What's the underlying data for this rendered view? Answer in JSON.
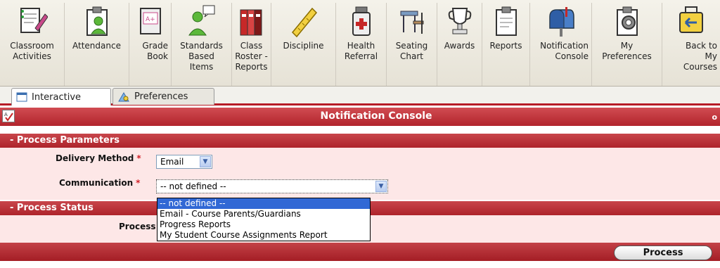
{
  "toolbar": {
    "items": [
      {
        "id": "classroom",
        "lines": [
          "Classroom",
          "Activities"
        ]
      },
      {
        "id": "attendance",
        "lines": [
          "Attendance"
        ]
      },
      {
        "id": "gradebook",
        "lines": [
          "Grade",
          "Book"
        ]
      },
      {
        "id": "standards",
        "lines": [
          "Standards",
          "Based",
          "Items"
        ]
      },
      {
        "id": "roster",
        "lines": [
          "Class",
          "Roster -",
          "Reports"
        ]
      },
      {
        "id": "discipline",
        "lines": [
          "Discipline"
        ]
      },
      {
        "id": "health",
        "lines": [
          "Health",
          "Referral"
        ]
      },
      {
        "id": "seating",
        "lines": [
          "Seating",
          "Chart"
        ]
      },
      {
        "id": "awards",
        "lines": [
          "Awards"
        ]
      },
      {
        "id": "reports",
        "lines": [
          "Reports"
        ]
      },
      {
        "id": "notification",
        "lines": [
          "Notification",
          "Console"
        ]
      },
      {
        "id": "preferences",
        "lines": [
          "My",
          "Preferences"
        ]
      },
      {
        "id": "back",
        "lines": [
          "Back to",
          "My",
          "Courses"
        ]
      }
    ]
  },
  "tabs": {
    "interactive": "Interactive",
    "preferences": "Preferences"
  },
  "header": {
    "title": "Notification Console",
    "right_mark": "o"
  },
  "params": {
    "section": "- Process Parameters",
    "delivery_label": "Delivery Method",
    "delivery_value": "Email",
    "communication_label": "Communication",
    "communication_value": "-- not defined --",
    "required_mark": "*"
  },
  "status": {
    "section": "- Process Status",
    "process_label": "Process"
  },
  "dropdown": {
    "options": [
      "-- not defined --",
      "Email - Course Parents/Guardians",
      "Progress Reports",
      "My Student Course Assignments Report"
    ]
  },
  "footer": {
    "process_button": "Process"
  },
  "colors": {
    "header_red": "#b2242c",
    "panel_pink": "#fde7e7",
    "selection_blue": "#3168d5"
  }
}
